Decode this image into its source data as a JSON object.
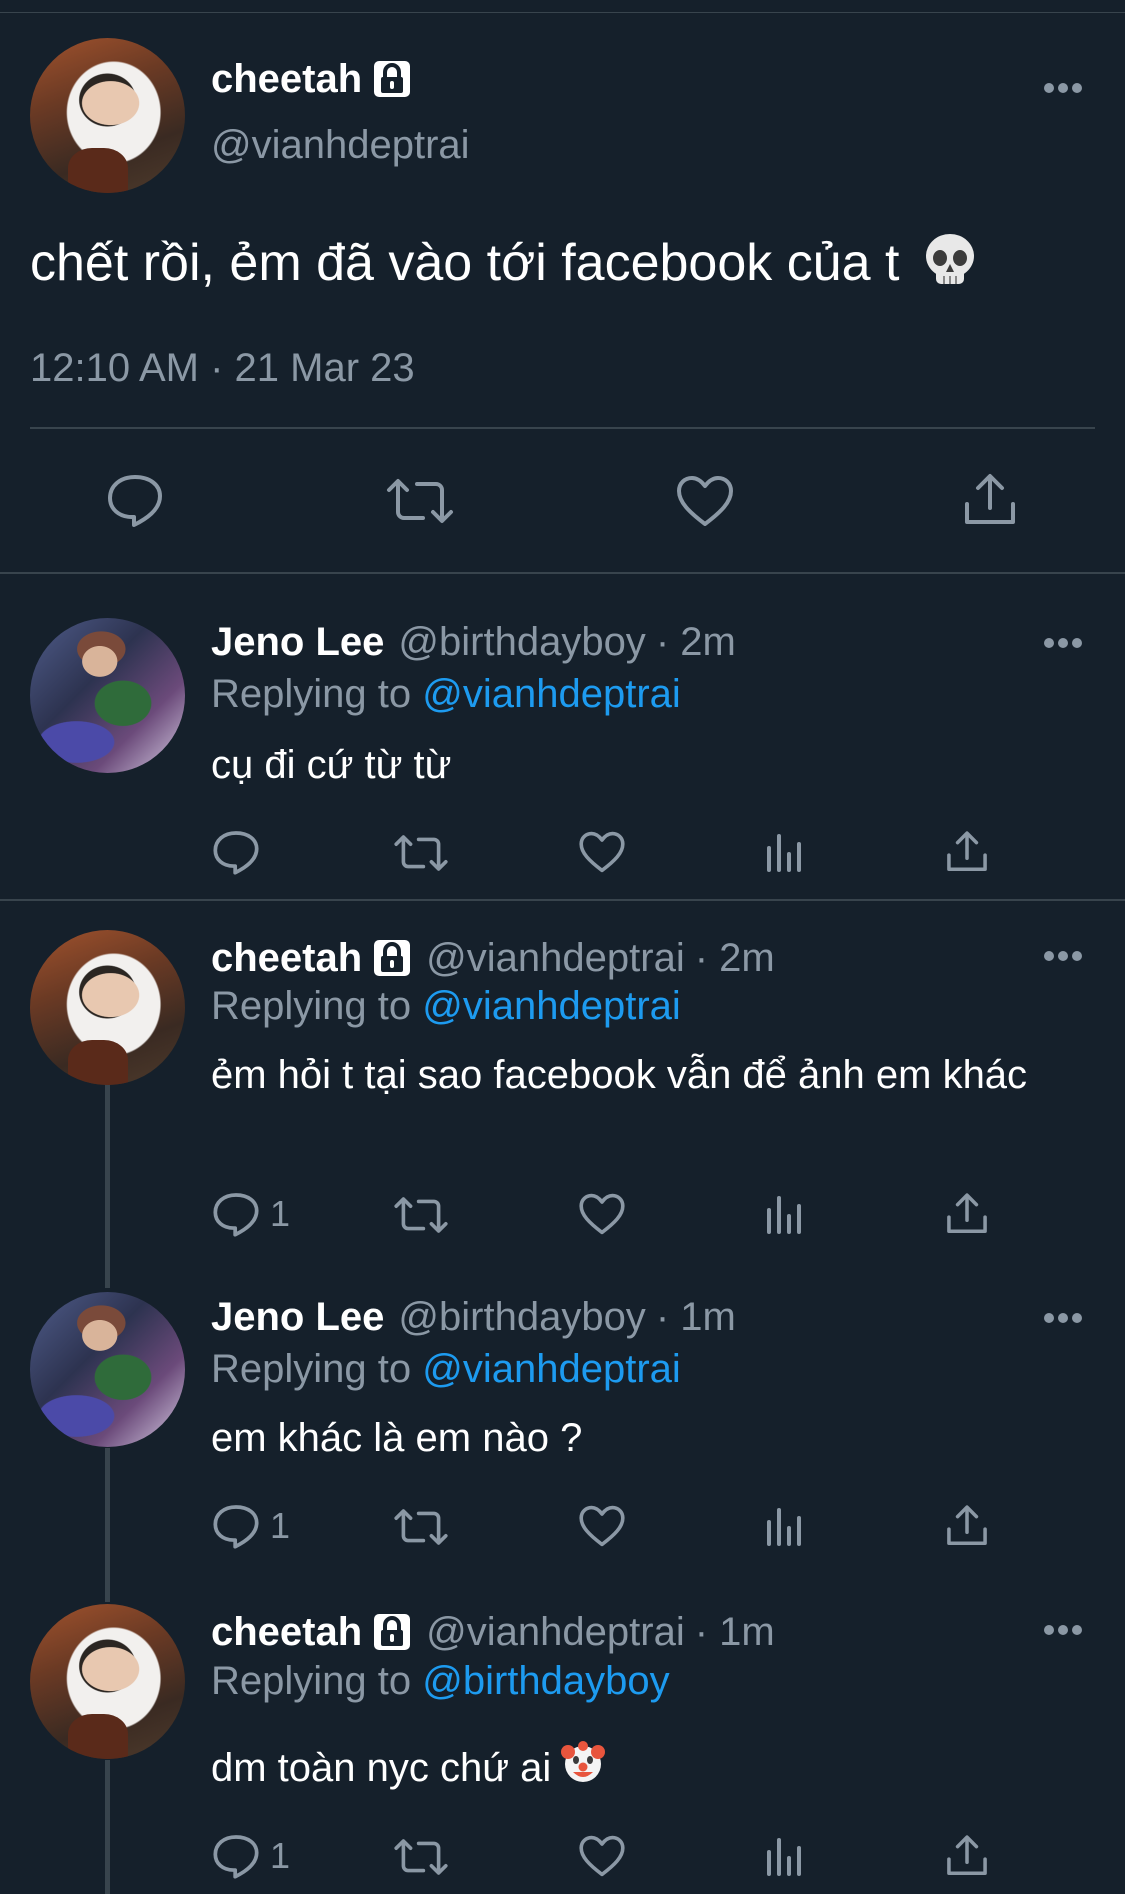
{
  "main_tweet": {
    "name": "cheetah",
    "handle": "@vianhdeptrai",
    "text": "chết rồi, ẻm đã vào tới facebook của t",
    "text_emoji": "skull-emoji",
    "timestamp": "12:10 AM · 21 Mar 23",
    "actions": [
      "reply-icon",
      "retweet-icon",
      "like-icon",
      "share-icon"
    ]
  },
  "replies": [
    {
      "name": "Jeno Lee",
      "handle": "@birthdayboy",
      "time": "· 2m",
      "replying_prefix": "Replying to ",
      "replying_to": "@vianhdeptrai",
      "text": "cụ đi cứ từ từ",
      "reply_count": "",
      "locked": false
    },
    {
      "name": "cheetah",
      "handle": "@vianhdeptrai",
      "time": "· 2m",
      "replying_prefix": "Replying to ",
      "replying_to": "@vianhdeptrai",
      "text": "ẻm hỏi t tại sao facebook vẫn để ảnh em khác",
      "reply_count": "1",
      "locked": true
    },
    {
      "name": "Jeno Lee",
      "handle": "@birthdayboy",
      "time": "· 1m",
      "replying_prefix": "Replying to ",
      "replying_to": "@vianhdeptrai",
      "text": "em khác là em nào ?",
      "reply_count": "1",
      "locked": false
    },
    {
      "name": "cheetah",
      "handle": "@vianhdeptrai",
      "time": "· 1m",
      "replying_prefix": "Replying to ",
      "replying_to": "@birthdayboy",
      "text": "dm toàn nyc chứ ai",
      "text_emoji": "clown-emoji",
      "reply_count": "1",
      "locked": true
    }
  ],
  "colors": {
    "background": "#15202b",
    "secondary_text": "#8b98a5",
    "link": "#1d9bf0",
    "divider": "#38444d"
  }
}
